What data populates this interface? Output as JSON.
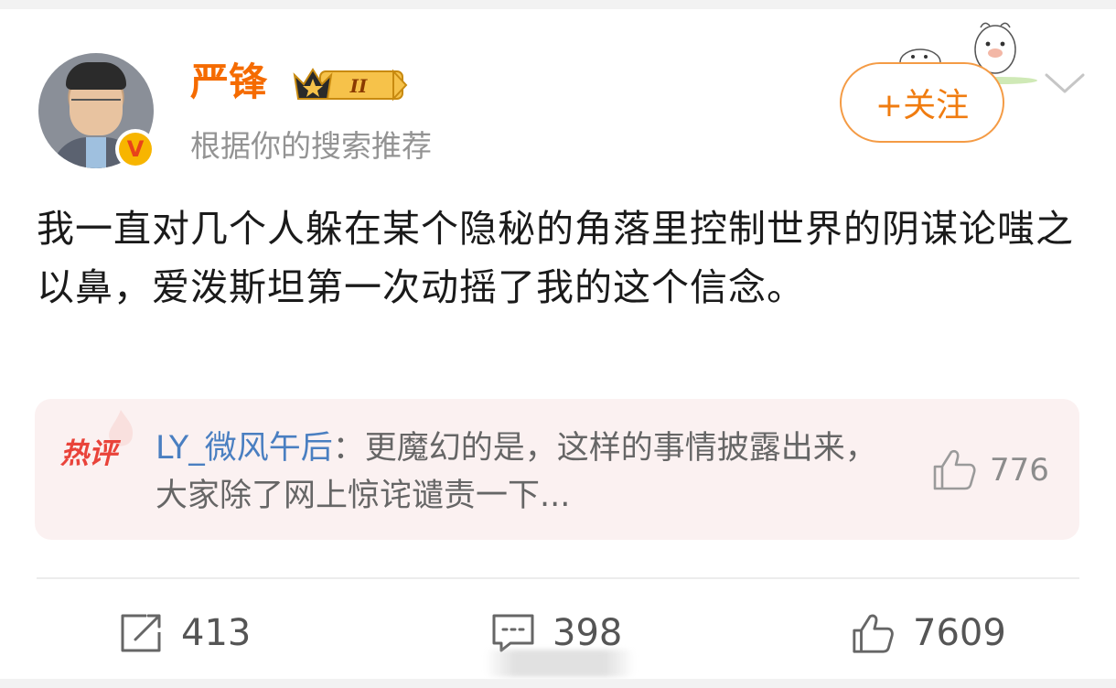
{
  "user": {
    "name": "严锋",
    "subtitle": "根据你的搜索推荐",
    "vip_level": "II"
  },
  "follow_button": {
    "label": "+关注"
  },
  "post": {
    "text": "我一直对几个人躲在某个隐秘的角落里控制世界的阴谋论嗤之以鼻，爱泼斯坦第一次动摇了我的这个信念。"
  },
  "hot_comment": {
    "tag": "热评",
    "username": "LY_微风午后",
    "separator": "：",
    "text": "更魔幻的是，这样的事情披露出来，大家除了网上惊诧谴责一下...",
    "like_count": "776"
  },
  "actions": {
    "repost_count": "413",
    "comment_count": "398",
    "like_count": "7609"
  },
  "colors": {
    "username": "#f56b00",
    "follow_border": "#f49b45",
    "hot_tag": "#e9433a",
    "comment_user": "#4a7fc1",
    "hot_bg": "#fbf1f1"
  },
  "icons": [
    "verified-icon",
    "vip-crown-icon",
    "mascot-icon",
    "chevron-down-icon",
    "hot-flame-icon",
    "thumb-up-icon",
    "repost-icon",
    "comment-icon"
  ]
}
